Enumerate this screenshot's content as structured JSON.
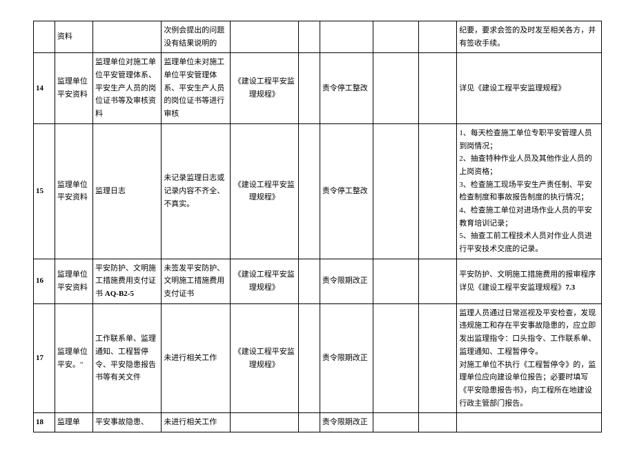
{
  "rows": [
    {
      "num": "",
      "cat": "资料",
      "item": "",
      "desc": "次例会提出的问题没有结果说明的",
      "ref": "",
      "blank1": "",
      "action": "",
      "blank2": "",
      "blank3": "",
      "note": "纪要，要求会签的及时发至相关各方，并有签收手续。"
    },
    {
      "num": "14",
      "cat": "监理单位平安资料",
      "item": "监理单位对施工单位平安管理体系、平安生产人员的岗位证书等及审核资料",
      "desc": "监理单位未对施工单位平安管理体系、平安生产人员的岗位证书等进行审核",
      "ref": "《建设工程平安监理规程》",
      "blank1": "",
      "action": "责令停工整改",
      "blank2": "",
      "blank3": "",
      "note": "详见《建设工程平安监理规程》"
    },
    {
      "num": "15",
      "cat": "监理单位平安资料",
      "item": "监理日志",
      "desc": "未记录监理日志或记录内容不齐全、不真实。",
      "ref": "《建设工程平安监理规程》",
      "blank1": "",
      "action": "责令停工整改",
      "blank2": "",
      "blank3": "",
      "note": "1、每天检查施工单位专职平安管理人员到岗情况；\n2、抽查特种作业人员及其他作业人员的上岗资格；\n3、检查施工现场平安生产责任制、平安检查制度和事故报告制度的执行情况；\n4、检查施工单位对进场作业人员的平安教育培训记录；\n5、抽查工前工程技术人员对作业人员进行平安技术交底的记录。"
    },
    {
      "num": "16",
      "cat": "监理单位平安资料",
      "item_pre": "平安防护、文明施工措施费用支付证书",
      "item_bold": " AQ-B2-5",
      "desc": "未签发平安防护、文明施工措施费用支付证书",
      "ref": "《建设工程平安监理规程》",
      "blank1": "",
      "action": "责令限期改正",
      "blank2": "",
      "blank3": "",
      "note_pre": "平安防护、文明施工措施费用的报审程序详见《建设工程平安监理规程》",
      "note_bold": "7.3"
    },
    {
      "num": "17",
      "cat": "监理单位平安。\"",
      "item": "工作联系单、监理通知、工程暂停令、平安隐患报告书等有关文件",
      "desc": "未进行相关工作",
      "ref": "《建设工程平安监理规程》",
      "blank1": "",
      "action": "责令限期改正",
      "blank2": "",
      "blank3": "",
      "note": "监理人员通过日常巡视及平安检查，发现违规施工和存在平安事故隐患的，应立即发出监理指令：口头指令、工作联系单、监理通知、工程暂停令。\n对施工单位不执行《工程暂停令》的，监理单位应向建设单位报告；必要时填写《平安隐患报告书》，向工程所在地建设行政主管部门报告。"
    },
    {
      "num": "18",
      "cat": "监理单",
      "item": "平安事故隐患、",
      "desc": "未进行相关工作",
      "ref": "",
      "blank1": "",
      "action": "责令限期改正",
      "blank2": "",
      "blank3": "",
      "note": ""
    }
  ]
}
